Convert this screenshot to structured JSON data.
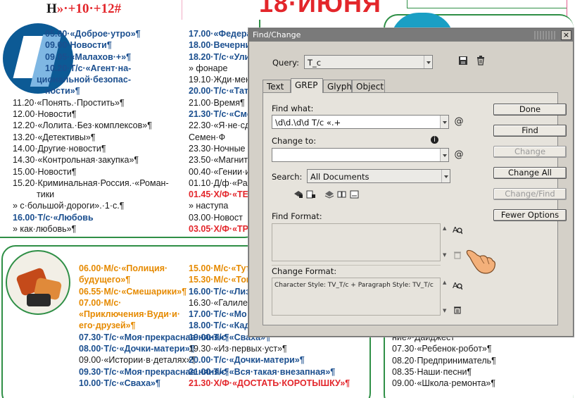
{
  "document": {
    "header": {
      "left_prefix": "Н",
      "left_rest": "»·+10·",
      "left_red": "+12",
      "left_hash": "#",
      "big_title": "18·ИЮНЯ",
      "big_hash": "#"
    },
    "col1": [
      {
        "cls": "blue",
        "text": "05.00·«Доброе·утро»¶",
        "ind": "ind2"
      },
      {
        "cls": "blue",
        "text": "09.00·Новости¶",
        "ind": "ind2"
      },
      {
        "cls": "blue",
        "text": "09.05·«Малахов·+»¶",
        "ind": "ind2"
      },
      {
        "cls": "blue",
        "text": "10.20·Т/с·«Агент·на-",
        "ind": "ind2"
      },
      {
        "cls": "blue",
        "text": "циональной·безопас-",
        "ind": "ind"
      },
      {
        "cls": "blue",
        "text": "ности»¶",
        "ind": "ind2"
      },
      {
        "cls": "",
        "text": "11.20·«Понять.·Простить»¶",
        "ind": ""
      },
      {
        "cls": "",
        "text": "12.00·Новости¶",
        "ind": ""
      },
      {
        "cls": "",
        "text": "12.20·«Лолита.·Без·комплексов»¶",
        "ind": ""
      },
      {
        "cls": "",
        "text": "13.20·«Детективы»¶",
        "ind": ""
      },
      {
        "cls": "",
        "text": "14.00·Другие·новости¶",
        "ind": ""
      },
      {
        "cls": "",
        "text": "14.30·«Контрольная·закупка»¶",
        "ind": ""
      },
      {
        "cls": "",
        "text": "15.00·Новости¶",
        "ind": ""
      },
      {
        "cls": "",
        "text": "15.20·Криминальная·Россия.·«Роман-",
        "ind": ""
      },
      {
        "cls": "",
        "text": "тики",
        "ind": "ind"
      },
      {
        "cls": "",
        "text": "»   с·большой·дороги».·1·с.¶",
        "ind": ""
      },
      {
        "cls": "blue",
        "text": "16.00·Т/с·«Любовь",
        "ind": ""
      },
      {
        "cls": "",
        "text": "»   как·любовь»¶",
        "ind": ""
      }
    ],
    "col2": [
      "17.00·«Федера",
      "18.00·Вечерни",
      "18.20·Т/с·«Ули",
      "»   фонаре",
      "19.10·Жди·мен",
      "20.00·Т/с·«Тат",
      "21.00·Время¶",
      "21.30·Т/с·«Сме",
      "22.30·«Я·не·сд",
      "Семен·Ф",
      "23.30·Ночные",
      "23.50·«Магнит",
      "00.40·«Гении·и",
      "01.10·Д/ф·«Ра",
      "01.45·Х/Ф·«ТЕ",
      "»   наступа",
      "03.00·Новост",
      "03.05·Х/Ф·«ТР"
    ],
    "col2_styles": [
      "blue",
      "blue",
      "blue",
      "",
      "",
      "blue",
      "",
      "blue",
      "",
      "",
      "",
      "",
      "",
      "",
      "red",
      "",
      "",
      "red"
    ],
    "col3": [
      {
        "cls": "orange",
        "text": "06.00·М/с·«Полиция·"
      },
      {
        "cls": "orange",
        "text": "будущего»¶"
      },
      {
        "cls": "orange",
        "text": "06.55·М/с·«Смешарики»¶"
      },
      {
        "cls": "orange",
        "text": "07.00·М/с·"
      },
      {
        "cls": "orange",
        "text": "«Приключения·Вуди·и·"
      },
      {
        "cls": "orange",
        "text": "его·друзей»¶"
      },
      {
        "cls": "blue",
        "text": "07.30·Т/с·«Моя·прекрасная·няня»¶"
      },
      {
        "cls": "blue",
        "text": "08.00·Т/с·«Дочки-матери»¶"
      },
      {
        "cls": "",
        "text": "09.00·«Истории·в·деталях»¶"
      },
      {
        "cls": "blue",
        "text": "09.30·Т/с·«Моя·прекрасная·няня»¶"
      },
      {
        "cls": "blue",
        "text": "10.00·Т/с·«Сваха»¶"
      }
    ],
    "col4": [
      {
        "cls": "orange",
        "text": "15.00·М/с·«Тут"
      },
      {
        "cls": "orange",
        "text": "15.30·М/с·«Том"
      },
      {
        "cls": "blue",
        "text": "16.00·Т/с·«Лиз"
      },
      {
        "cls": "",
        "text": "16.30·«Галиле"
      },
      {
        "cls": "blue",
        "text": "17.00·Т/с·«Мо"
      },
      {
        "cls": "blue",
        "text": "18.00·Т/с·«Кад"
      },
      {
        "cls": "blue",
        "text": "19.00·Т/с·«Сваха»¶"
      },
      {
        "cls": "",
        "text": "19.30·«Из·первых·уст»¶"
      },
      {
        "cls": "blue",
        "text": "20.00·Т/с·«Дочки-матери»¶"
      },
      {
        "cls": "blue",
        "text": "21.00·Т/с·«Вся·такая·внезапная»¶"
      },
      {
        "cls": "red",
        "text": "21.30·Х/Ф·«ДОСТАТЬ·КОРОТЫШКУ»¶"
      }
    ],
    "col5": [
      {
        "cls": "",
        "text": "ние»·Дайджест"
      },
      {
        "cls": "",
        "text": "07.30·«Ребенок-робот»¶"
      },
      {
        "cls": "",
        "text": "08.20·Предприниматель¶"
      },
      {
        "cls": "",
        "text": "08.35·Наши·песни¶"
      },
      {
        "cls": "",
        "text": "09.00·«Школа·ремонта»¶"
      }
    ]
  },
  "dialog": {
    "title": "Find/Change",
    "close": "×",
    "query_label": "Query:",
    "query_value": "T_c",
    "tabs": [
      "Text",
      "GREP",
      "Glyph",
      "Object"
    ],
    "active_tab": 1,
    "find_what_label": "Find what:",
    "find_what_value": "\\d\\d.\\d\\d T/c «.+",
    "change_to_label": "Change to:",
    "change_to_value": "",
    "search_label": "Search:",
    "search_value": "All Documents",
    "find_format_label": "Find Format:",
    "change_format_label": "Change Format:",
    "change_format_value": "Character Style: TV_T/c + Paragraph Style: TV_T/c",
    "buttons": {
      "done": "Done",
      "find": "Find",
      "change": "Change",
      "change_all": "Change All",
      "change_find": "Change/Find",
      "fewer_options": "Fewer Options"
    },
    "icons": {
      "save_query": "save-icon",
      "delete_query": "trash-icon",
      "special_chars": "@",
      "info": "i"
    }
  },
  "colors": {
    "listing_blue": "#1b4f8f",
    "listing_red": "#e3262b",
    "listing_orange": "#e68a00",
    "panel_green": "#2f8f46",
    "dialog_bg": "#d4d0c8"
  }
}
